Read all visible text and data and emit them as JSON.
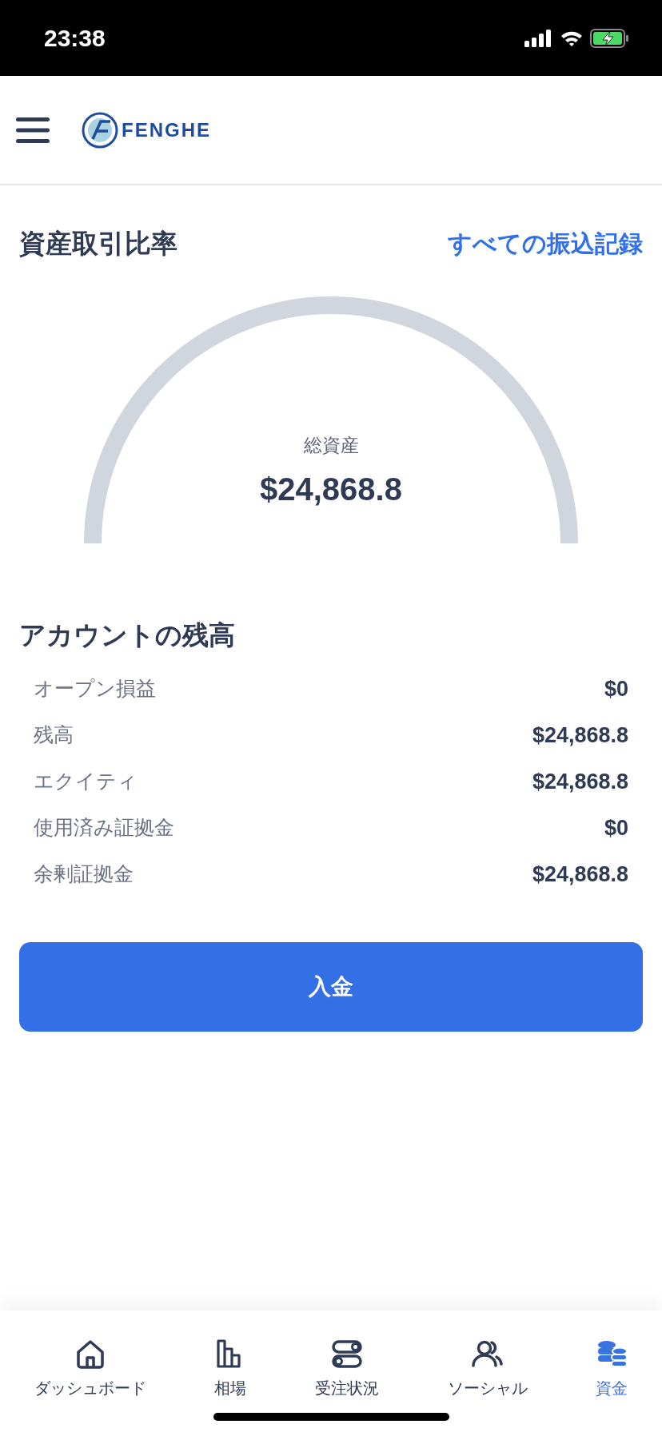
{
  "status_bar": {
    "time": "23:38"
  },
  "header": {
    "logo_text": "FENGHE"
  },
  "ratio_section": {
    "title": "資産取引比率",
    "link": "すべての振込記録",
    "gauge": {
      "label": "総資産",
      "value": "$24,868.8"
    }
  },
  "balance": {
    "title": "アカウントの残高",
    "rows": [
      {
        "label": "オープン損益",
        "value": "$0"
      },
      {
        "label": "残高",
        "value": "$24,868.8"
      },
      {
        "label": "エクイティ",
        "value": "$24,868.8"
      },
      {
        "label": "使用済み証拠金",
        "value": "$0"
      },
      {
        "label": "余剰証拠金",
        "value": "$24,868.8"
      }
    ]
  },
  "deposit_button": "入金",
  "tab_bar": [
    {
      "label": "ダッシュボード",
      "selected": false
    },
    {
      "label": "相場",
      "selected": false
    },
    {
      "label": "受注状況",
      "selected": false
    },
    {
      "label": "ソーシャル",
      "selected": false
    },
    {
      "label": "資金",
      "selected": true
    }
  ]
}
